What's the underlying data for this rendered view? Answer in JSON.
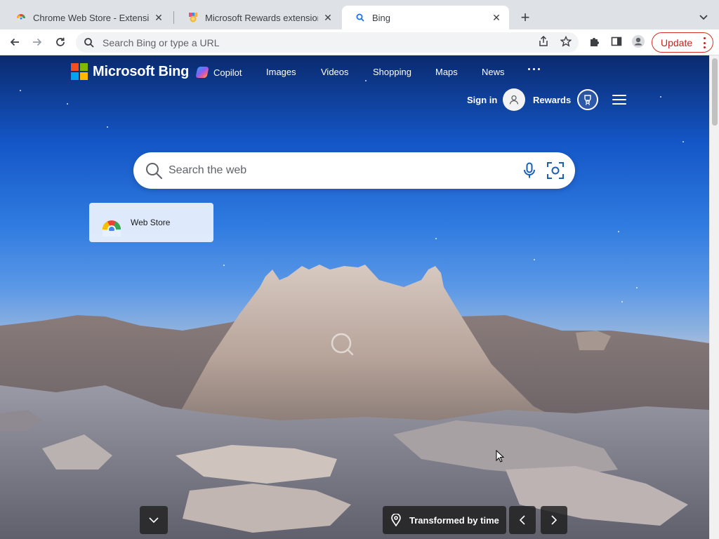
{
  "browser": {
    "tabs": [
      {
        "title": "Chrome Web Store - Extensions",
        "favicon": "chrome-web-store-icon",
        "active": false
      },
      {
        "title": "Microsoft Rewards extension",
        "favicon": "rewards-extension-icon",
        "active": false
      },
      {
        "title": "Bing",
        "favicon": "bing-search-icon",
        "active": true
      }
    ],
    "new_tab_label": "+",
    "omnibox": {
      "placeholder": "Search Bing or type a URL"
    },
    "update_label": "Update"
  },
  "bing": {
    "brand": "Microsoft Bing",
    "nav": [
      {
        "label": "Copilot",
        "icon": "copilot-icon"
      },
      {
        "label": "Images"
      },
      {
        "label": "Videos"
      },
      {
        "label": "Shopping"
      },
      {
        "label": "Maps"
      },
      {
        "label": "News"
      }
    ],
    "signin_label": "Sign in",
    "rewards_label": "Rewards",
    "search_placeholder": "Search the web",
    "quick_link": {
      "label": "Web Store",
      "icon": "chrome-web-store-icon"
    },
    "image_caption": "Transformed by time"
  },
  "colors": {
    "ms_red": "#f25022",
    "ms_green": "#7fba00",
    "ms_blue": "#00a4ef",
    "ms_yellow": "#ffb900",
    "update_red": "#c5221f"
  }
}
